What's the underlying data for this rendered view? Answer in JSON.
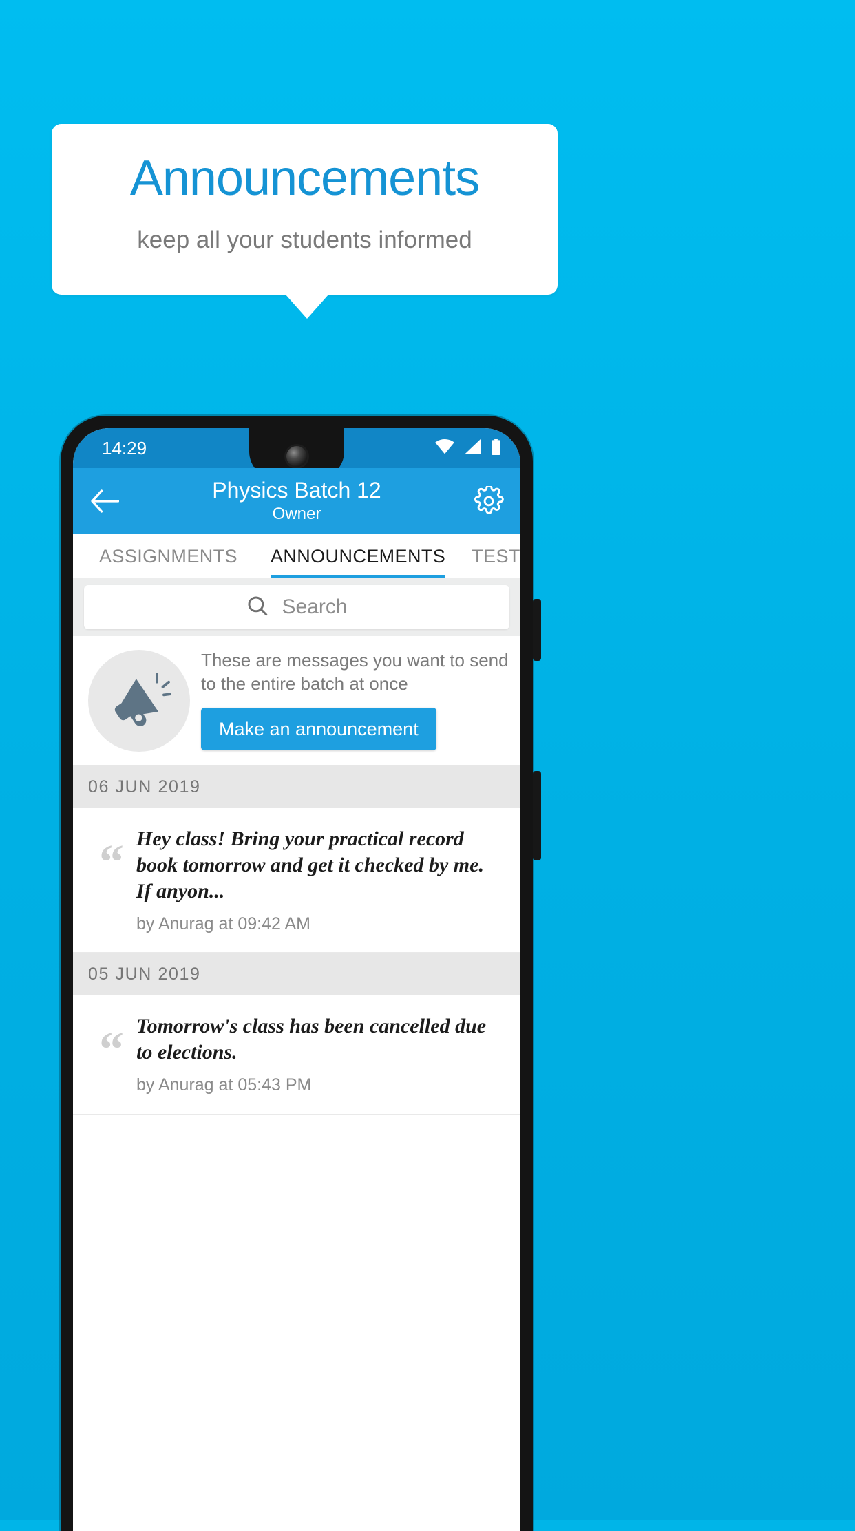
{
  "banner": {
    "title": "Announcements",
    "subtitle": "keep all your students informed",
    "title_color": "#1593d4",
    "subtitle_color": "#7a7a7a"
  },
  "background_color": "#00b5e8",
  "phone": {
    "statusbar": {
      "time": "14:29",
      "icons": [
        "wifi-icon",
        "signal-icon",
        "battery-icon"
      ],
      "background_color": "#1186c6"
    },
    "appbar": {
      "back_icon": "back-arrow-icon",
      "title": "Physics Batch 12",
      "subtitle": "Owner",
      "settings_icon": "gear-icon",
      "background_color": "#1e9fe0"
    },
    "tabs": [
      {
        "label": "ASSIGNMENTS",
        "active": false
      },
      {
        "label": "ANNOUNCEMENTS",
        "active": true
      },
      {
        "label": "TESTS",
        "active": false
      }
    ],
    "search": {
      "icon": "search-icon",
      "placeholder": "Search",
      "value": ""
    },
    "promo": {
      "icon": "megaphone-icon",
      "text": "These are messages you want to send to the entire batch at once",
      "button_label": "Make an announcement",
      "button_color": "#1e9fe0"
    },
    "groups": [
      {
        "date": "06  JUN  2019",
        "items": [
          {
            "text": "Hey class! Bring your practical record book tomorrow and get it checked by me. If anyon...",
            "meta": "by Anurag at 09:42 AM"
          }
        ]
      },
      {
        "date": "05  JUN  2019",
        "items": [
          {
            "text": "Tomorrow's class has been cancelled due to elections.",
            "meta": "by Anurag at 05:43 PM"
          }
        ]
      }
    ]
  }
}
